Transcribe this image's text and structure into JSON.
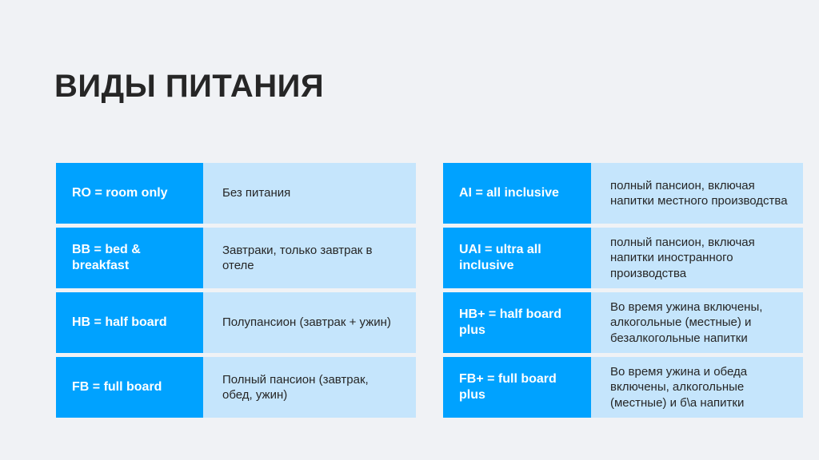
{
  "title": "ВИДЫ ПИТАНИЯ",
  "colors": {
    "background": "#f0f2f5",
    "code_cell": "#00a2ff",
    "desc_cell": "#c5e5fc",
    "title_text": "#262626"
  },
  "tables": {
    "left": [
      {
        "code": "RO = room only",
        "description": "Без питания"
      },
      {
        "code": "BB = bed & breakfast",
        "description": "Завтраки, только завтрак в отеле"
      },
      {
        "code": "HB = half board",
        "description": "Полупансион (завтрак + ужин)"
      },
      {
        "code": "FB = full board",
        "description": "Полный пансион (завтрак, обед, ужин)"
      }
    ],
    "right": [
      {
        "code": "AI = all inclusive",
        "description": "полный пансион, включая напитки местного производства"
      },
      {
        "code": "UAI = ultra all inclusive",
        "description": "полный пансион, включая напитки иностранного производства"
      },
      {
        "code": "HB+ = half board plus",
        "description": "Во время ужина включены, алкогольные (местные) и безалкогольные напитки"
      },
      {
        "code": "FB+ = full board plus",
        "description": "Во время ужина и обеда включены, алкогольные (местные) и б\\а напитки"
      }
    ]
  }
}
